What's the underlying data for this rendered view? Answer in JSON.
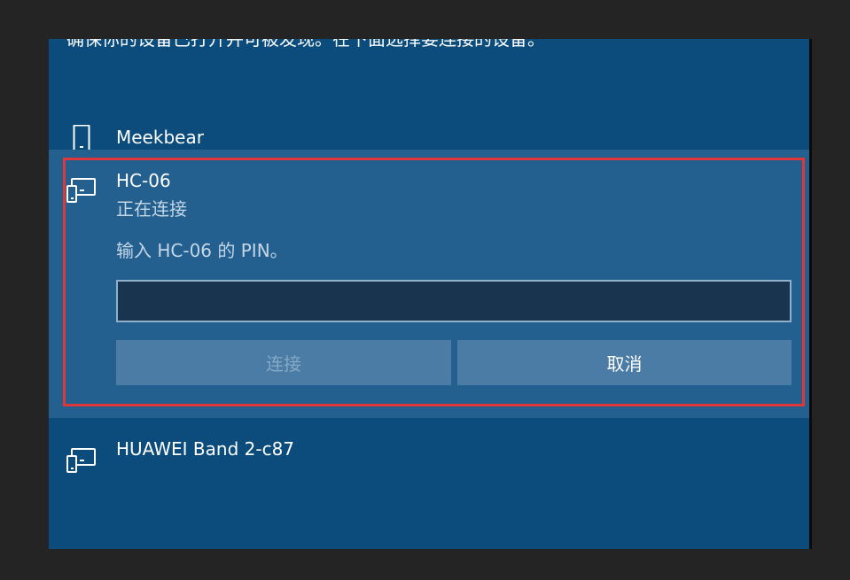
{
  "intro_text": "确保你的设备已打开并可被发现。在下面选择要连接的设备。",
  "devices": [
    {
      "name": "Meekbear",
      "icon": "phone-icon"
    },
    {
      "name": "HC-06",
      "icon": "device-icon",
      "status": "正在连接",
      "pin_prompt": "输入 HC-06 的 PIN。",
      "pin_value": "",
      "connect_label": "连接",
      "cancel_label": "取消"
    },
    {
      "name": "HUAWEI Band 2-c87",
      "icon": "device-icon"
    }
  ],
  "colors": {
    "panel_bg": "#0b4c7c",
    "selected_bg": "#24608f",
    "button_bg": "#4a7ca6",
    "input_bg": "#18344f",
    "highlight_border": "#e0383a"
  }
}
